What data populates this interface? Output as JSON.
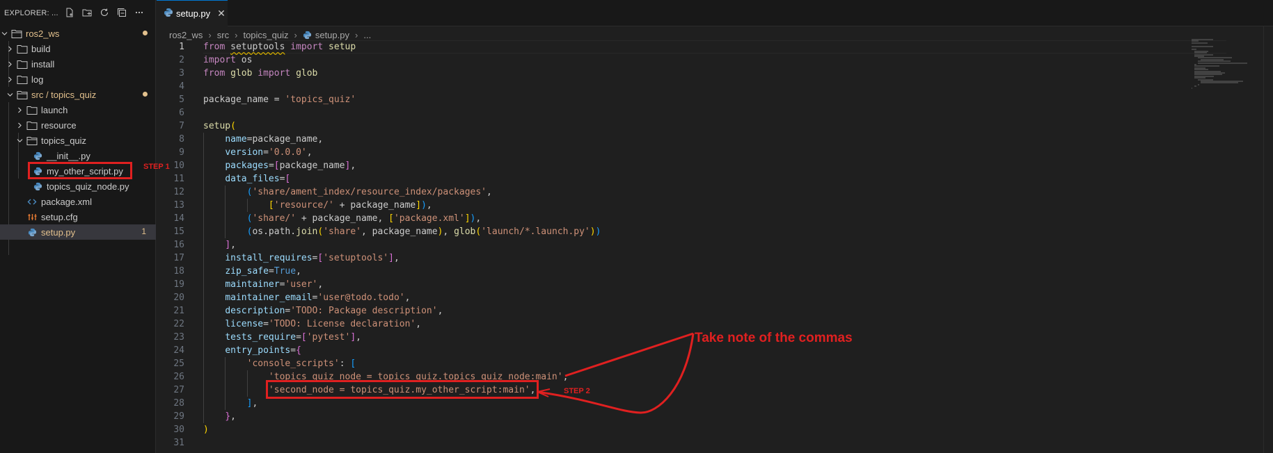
{
  "explorer": {
    "title": "EXPLORER: ...",
    "actions": [
      "new-file-icon",
      "new-folder-icon",
      "refresh-icon",
      "collapse-all-icon",
      "more-icon"
    ],
    "tree": [
      {
        "label": "ros2_ws",
        "depth": 0,
        "type": "folder-open",
        "modified": true
      },
      {
        "label": "build",
        "depth": 1,
        "type": "folder"
      },
      {
        "label": "install",
        "depth": 1,
        "type": "folder"
      },
      {
        "label": "log",
        "depth": 1,
        "type": "folder"
      },
      {
        "label": "src / topics_quiz",
        "depth": 1,
        "type": "folder-open",
        "modified": true
      },
      {
        "label": "launch",
        "depth": 2,
        "type": "folder"
      },
      {
        "label": "resource",
        "depth": 2,
        "type": "folder"
      },
      {
        "label": "topics_quiz",
        "depth": 2,
        "type": "folder-open"
      },
      {
        "label": "__init__.py",
        "depth": 3,
        "type": "python"
      },
      {
        "label": "my_other_script.py",
        "depth": 3,
        "type": "python"
      },
      {
        "label": "topics_quiz_node.py",
        "depth": 3,
        "type": "python"
      },
      {
        "label": "package.xml",
        "depth": 2,
        "type": "xml"
      },
      {
        "label": "setup.cfg",
        "depth": 2,
        "type": "cfg"
      },
      {
        "label": "setup.py",
        "depth": 2,
        "type": "python",
        "active": true,
        "badge": "1"
      }
    ]
  },
  "tab": {
    "label": "setup.py",
    "close": "✕"
  },
  "breadcrumb": [
    "ros2_ws",
    "src",
    "topics_quiz",
    "setup.py",
    "..."
  ],
  "code_lines": [
    "from setuptools import setup",
    "import os",
    "from glob import glob",
    "",
    "package_name = 'topics_quiz'",
    "",
    "setup(",
    "    name=package_name,",
    "    version='0.0.0',",
    "    packages=[package_name],",
    "    data_files=[",
    "        ('share/ament_index/resource_index/packages',",
    "            ['resource/' + package_name]),",
    "        ('share/' + package_name, ['package.xml']),",
    "        (os.path.join('share', package_name), glob('launch/*.launch.py'))",
    "    ],",
    "    install_requires=['setuptools'],",
    "    zip_safe=True,",
    "    maintainer='user',",
    "    maintainer_email='user@todo.todo',",
    "    description='TODO: Package description',",
    "    license='TODO: License declaration',",
    "    tests_require=['pytest'],",
    "    entry_points={",
    "        'console_scripts': [",
    "            'topics_quiz_node = topics_quiz.topics_quiz_node:main',",
    "            'second_node = topics_quiz.my_other_script:main',",
    "        ],",
    "    },",
    ")",
    ""
  ],
  "annotations": {
    "step1": "STEP 1",
    "step2": "STEP 2",
    "note": "Take note of the commas",
    "color": "#e02020"
  },
  "colors": {
    "keyword": "#c586c0",
    "string": "#ce9178",
    "variable": "#9cdcfe",
    "function": "#dcdcaa",
    "builtin": "#569cd6",
    "modified": "#e2c08d"
  }
}
